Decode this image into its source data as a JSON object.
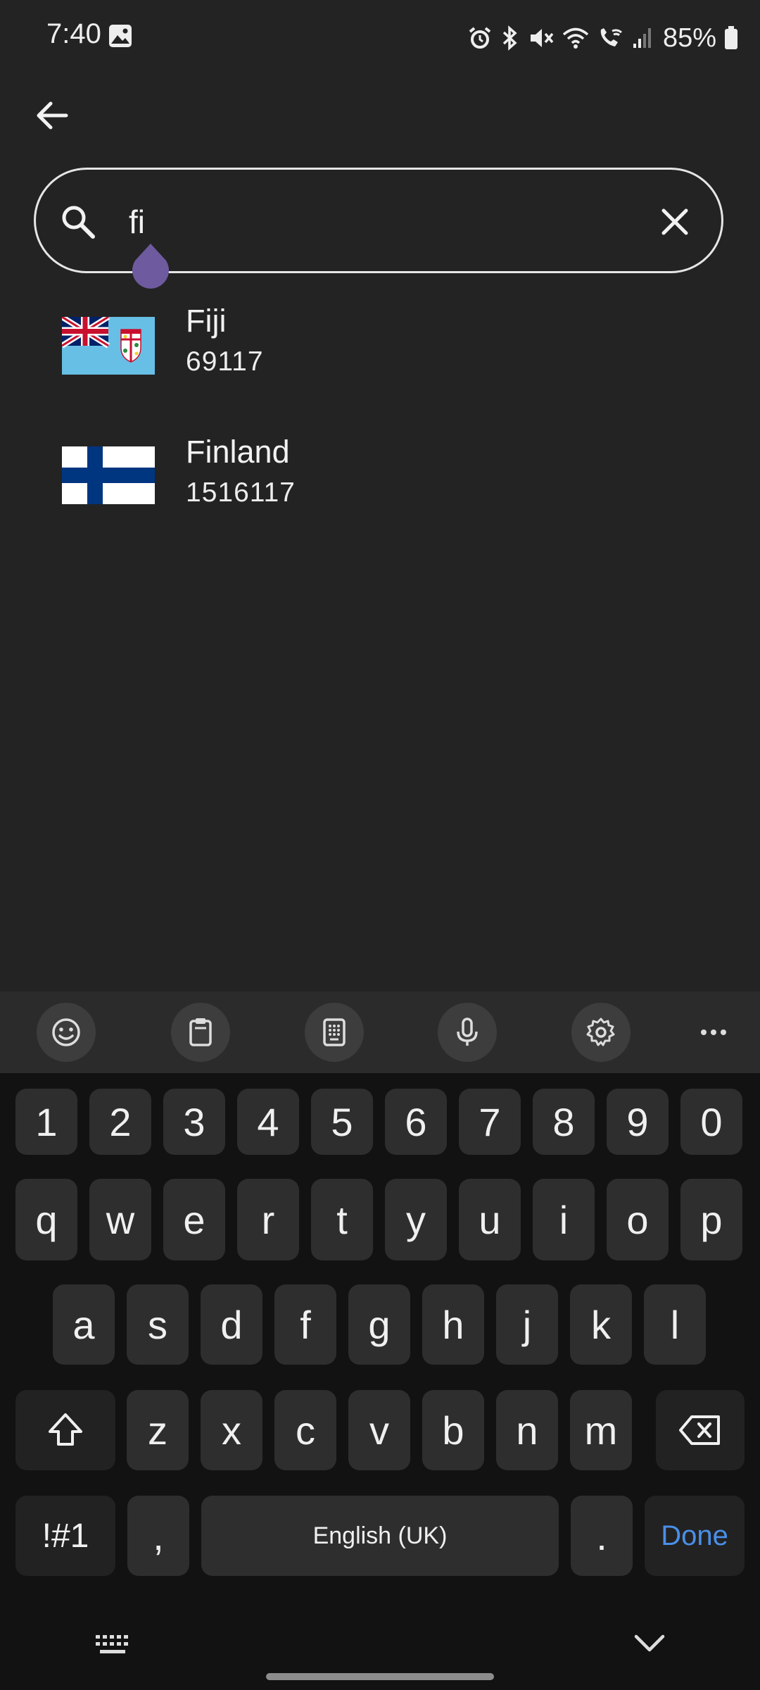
{
  "status_bar": {
    "time": "7:40",
    "battery": "85%",
    "icons": [
      "gallery-icon",
      "alarm-icon",
      "bluetooth-icon",
      "mute-icon",
      "wifi-icon",
      "wifi-calling-icon",
      "signal-icon",
      "battery-icon"
    ]
  },
  "search": {
    "query": "fi",
    "icons": [
      "back-arrow-icon",
      "search-icon",
      "clear-icon"
    ]
  },
  "results": [
    {
      "name": "Fiji",
      "population": "69117",
      "flag": "fiji-flag"
    },
    {
      "name": "Finland",
      "population": "1516117",
      "flag": "finland-flag"
    }
  ],
  "keyboard": {
    "toolbar": [
      "emoji-icon",
      "clipboard-icon",
      "keypad-icon",
      "mic-icon",
      "settings-icon",
      "more-icon"
    ],
    "number_row": [
      "1",
      "2",
      "3",
      "4",
      "5",
      "6",
      "7",
      "8",
      "9",
      "0"
    ],
    "row1": [
      "q",
      "w",
      "e",
      "r",
      "t",
      "y",
      "u",
      "i",
      "o",
      "p"
    ],
    "row2": [
      "a",
      "s",
      "d",
      "f",
      "g",
      "h",
      "j",
      "k",
      "l"
    ],
    "row3": [
      "z",
      "x",
      "c",
      "v",
      "b",
      "n",
      "m"
    ],
    "symbols_label": "!#1",
    "comma": ",",
    "space_label": "English (UK)",
    "period": ".",
    "done_label": "Done"
  },
  "colors": {
    "background": "#232323",
    "keyboard_bg": "#121212",
    "key_bg": "#2e2e2e",
    "accent_done": "#4a8fe8",
    "cursor_handle": "#6e5a9e"
  }
}
